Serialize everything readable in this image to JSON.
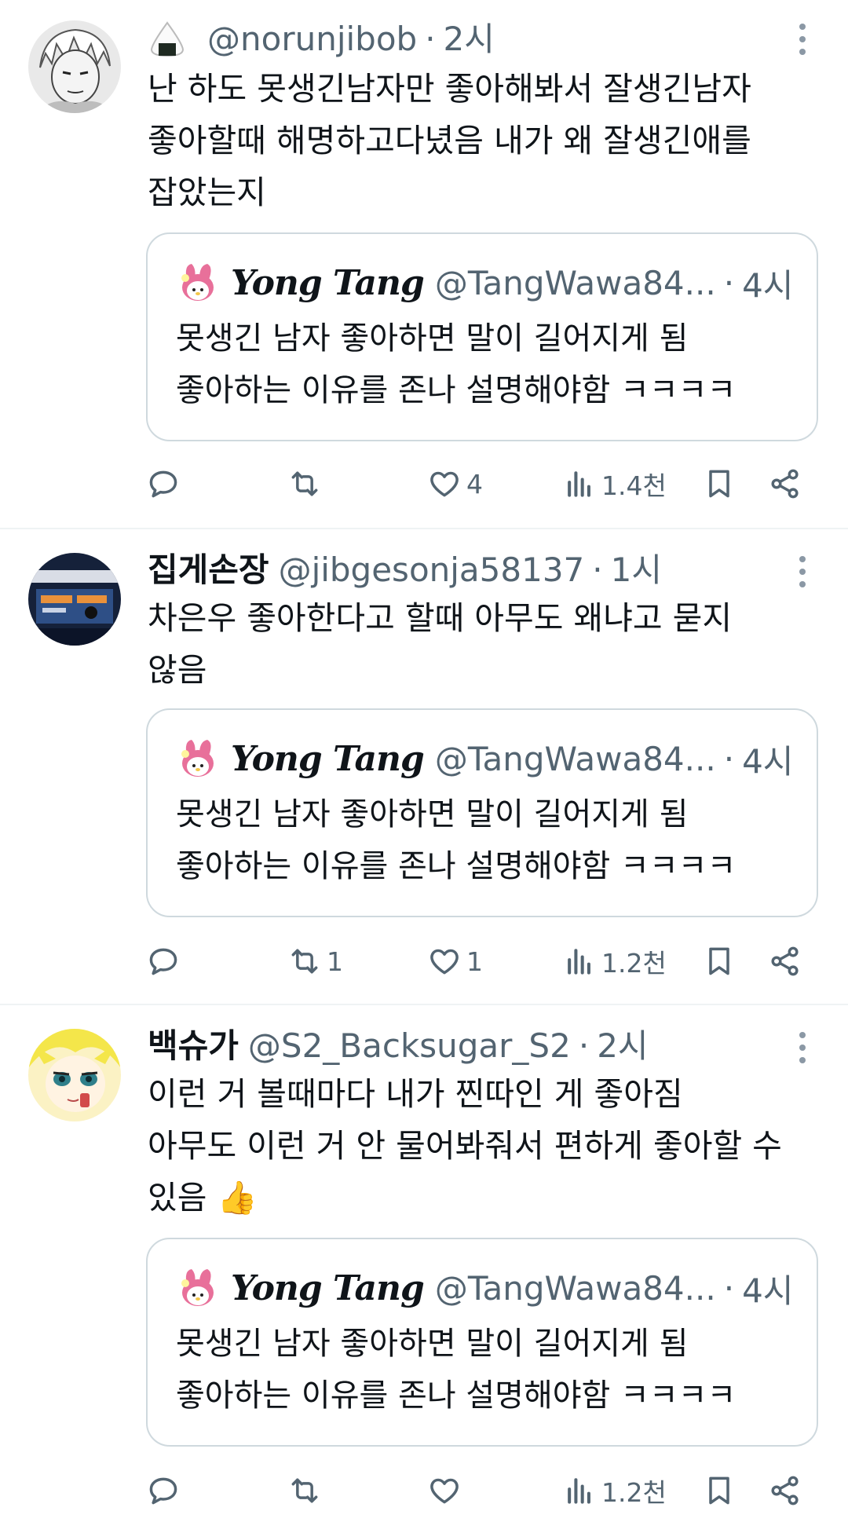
{
  "tweets": [
    {
      "name": "",
      "name_emoji": "rice-ball-emoji",
      "handle": "@norunjibob",
      "time": "2시",
      "text": "난 하도 못생긴남자만 좋아해봐서 잘생긴남자\n좋아할때 해명하고다녔음 내가 왜 잘생긴애를\n잡았는지",
      "quote": {
        "name": "Yong Tang",
        "handle": "@TangWawa84...",
        "time": "4시",
        "text": "못생긴 남자 좋아하면 말이 길어지게 됨\n좋아하는 이유를 존나 설명해야함 ㅋㅋㅋㅋ"
      },
      "stats": {
        "replies": "",
        "reposts": "",
        "likes": "4",
        "views": "1.4천"
      }
    },
    {
      "name": "집게손장",
      "handle": "@jibgesonja58137",
      "time": "1시",
      "text": "차은우 좋아한다고 할때 아무도 왜냐고 묻지\n않음",
      "quote": {
        "name": "Yong Tang",
        "handle": "@TangWawa84...",
        "time": "4시",
        "text": "못생긴 남자 좋아하면 말이 길어지게 됨\n좋아하는 이유를 존나 설명해야함 ㅋㅋㅋㅋ"
      },
      "stats": {
        "replies": "",
        "reposts": "1",
        "likes": "1",
        "views": "1.2천"
      }
    },
    {
      "name": "백슈가",
      "handle": "@S2_Backsugar_S2",
      "time": "2시",
      "text": "이런 거 볼때마다 내가 찐따인 게 좋아짐\n아무도 이런 거 안 물어봐줘서 편하게 좋아할 수\n있음 👍",
      "quote": {
        "name": "Yong Tang",
        "handle": "@TangWawa84...",
        "time": "4시",
        "text": "못생긴 남자 좋아하면 말이 길어지게 됨\n좋아하는 이유를 존나 설명해야함 ㅋㅋㅋㅋ"
      },
      "stats": {
        "replies": "",
        "reposts": "",
        "likes": "",
        "views": "1.2천"
      }
    }
  ],
  "separator": "·",
  "colors": {
    "text": "#0f1419",
    "secondary": "#536471",
    "border": "#cfd9de",
    "divider": "#eff3f4"
  }
}
